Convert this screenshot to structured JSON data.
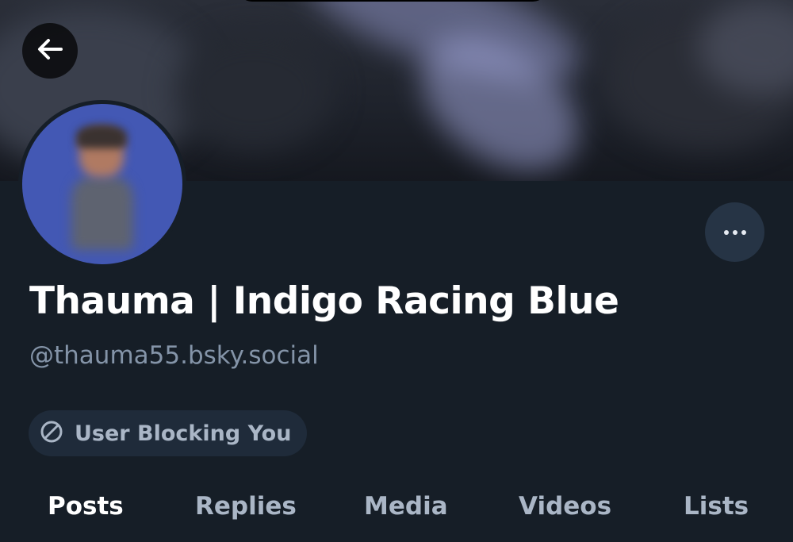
{
  "profile": {
    "display_name": "Thauma | Indigo Racing Blue",
    "handle": "@thauma55.bsky.social",
    "status_badge": "User Blocking You"
  },
  "icons": {
    "back": "arrow-left-icon",
    "more": "ellipsis-icon",
    "blocked": "block-icon"
  },
  "tabs": [
    {
      "label": "Posts",
      "active": true
    },
    {
      "label": "Replies",
      "active": false
    },
    {
      "label": "Media",
      "active": false
    },
    {
      "label": "Videos",
      "active": false
    },
    {
      "label": "Lists",
      "active": false
    }
  ],
  "colors": {
    "background": "#161e27",
    "avatar_bg": "#4358b4",
    "muted_text": "#8494a8",
    "pill_bg": "#1f2b3a"
  }
}
